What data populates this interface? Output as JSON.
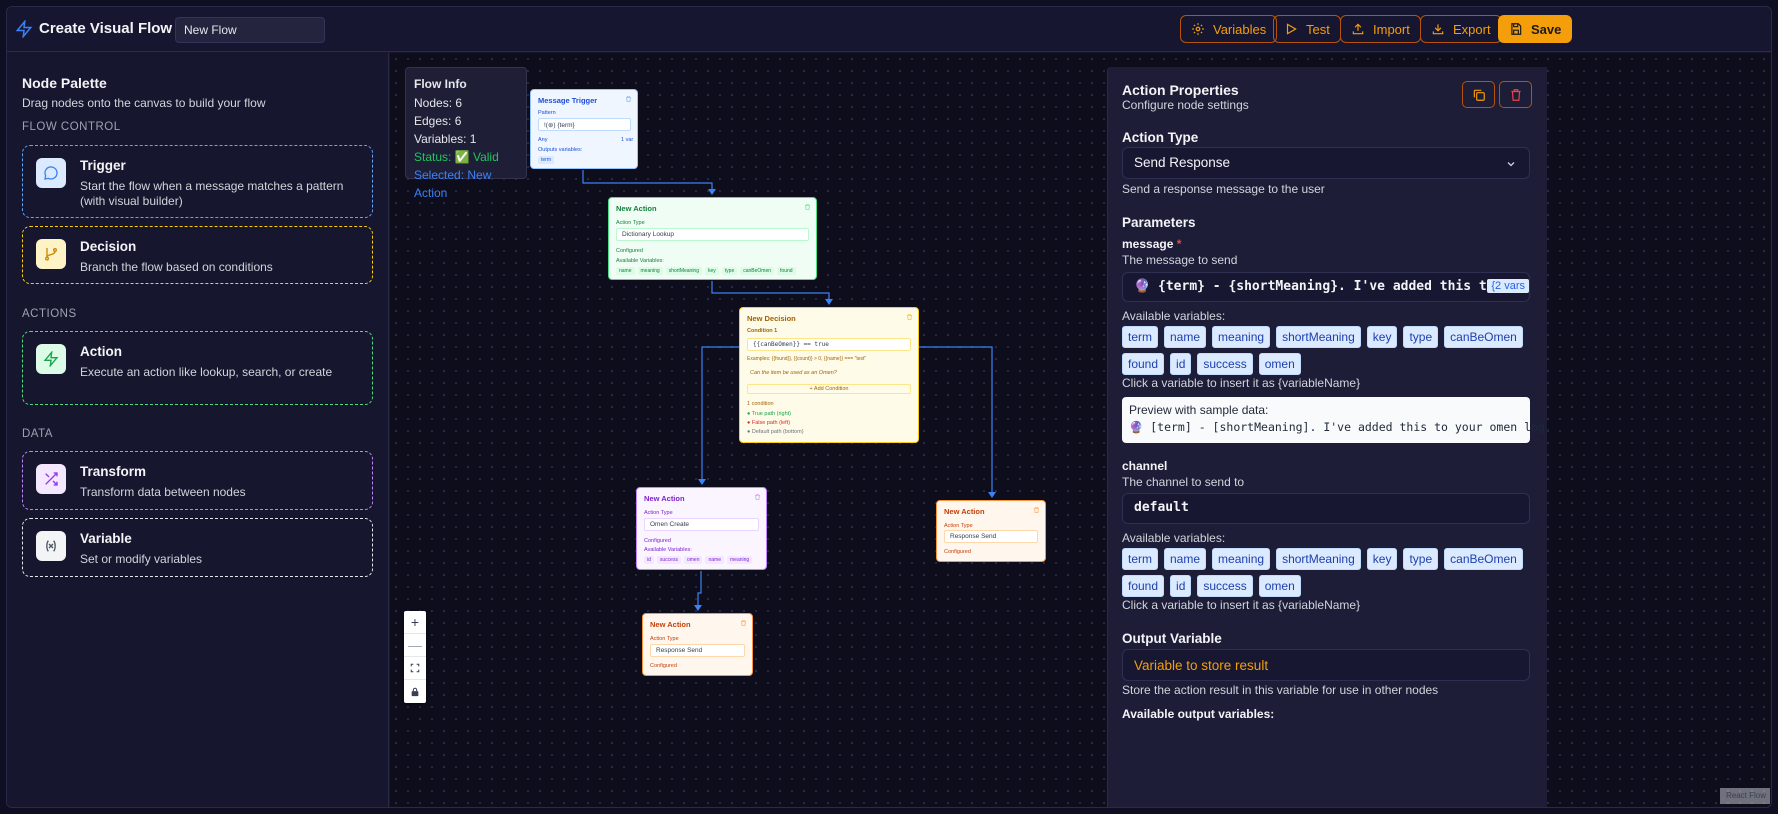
{
  "header": {
    "title": "Create Visual Flow",
    "flow_name": "New Flow",
    "buttons": {
      "variables": "Variables",
      "test": "Test",
      "import": "Import",
      "export": "Export",
      "save": "Save"
    }
  },
  "palette": {
    "title": "Node Palette",
    "subtitle": "Drag nodes onto the canvas to build your flow",
    "sections": {
      "flow_control": "FLOW CONTROL",
      "actions": "ACTIONS",
      "data": "DATA"
    },
    "items": [
      {
        "name": "Trigger",
        "desc": "Start the flow when a message matches a pattern (with visual builder)",
        "color": "#60a5fa",
        "icon": "message-circle-icon"
      },
      {
        "name": "Decision",
        "desc": "Branch the flow based on conditions",
        "color": "#facc15",
        "icon": "git-branch-icon"
      },
      {
        "name": "Action",
        "desc": "Execute an action like lookup, search, or create",
        "color": "#4ade80",
        "icon": "zap-icon"
      },
      {
        "name": "Transform",
        "desc": "Transform data between nodes",
        "color": "#c084fc",
        "icon": "shuffle-icon"
      },
      {
        "name": "Variable",
        "desc": "Set or modify variables",
        "color": "#c084fc",
        "icon": "variable-icon"
      }
    ]
  },
  "flow_info": {
    "title": "Flow Info",
    "nodes": "Nodes: 6",
    "edges": "Edges: 6",
    "variables": "Variables: 1",
    "status": "Status: ✅ Valid",
    "selected": "Selected: New Action"
  },
  "nodes": {
    "trigger": {
      "title": "Message Trigger",
      "pattern_label": "Pattern",
      "pattern": "!(⊛) {term}",
      "any": "Any",
      "var_count": "1 var",
      "outputs_label": "Outputs variables:",
      "outputs": [
        "term"
      ]
    },
    "action1": {
      "title": "New Action",
      "type_label": "Action Type",
      "type": "Dictionary Lookup",
      "status": "Configured",
      "vars_label": "Available Variables:",
      "vars": [
        "name",
        "meaning",
        "shortMeaning",
        "key",
        "type",
        "canBeOmen",
        "found"
      ]
    },
    "decision": {
      "title": "New Decision",
      "cond_label": "Condition 1",
      "cond": "{{canBeOmen}} == true",
      "example": "Examples: {{found}}, {{count}} > 0, {{name}} === \"test\"",
      "question": "Can the item be used as an Omen?",
      "add": "+ Add Condition",
      "count": "1 condition",
      "true_path": "True path (right)",
      "false_path": "False path (left)",
      "default_path": "Default path (bottom)"
    },
    "action2": {
      "title": "New Action",
      "type_label": "Action Type",
      "type": "Omen Create",
      "status": "Configured",
      "vars_label": "Available Variables:",
      "vars": [
        "id",
        "success",
        "omen",
        "name",
        "meaning"
      ]
    },
    "action3": {
      "title": "New Action",
      "type_label": "Action Type",
      "type": "Response Send",
      "status": "Configured"
    },
    "action4": {
      "title": "New Action",
      "type_label": "Action Type",
      "type": "Response Send",
      "status": "Configured"
    }
  },
  "zoom": {
    "in": "+",
    "out": "—"
  },
  "attribution": "React Flow",
  "props": {
    "title": "Action Properties",
    "subtitle": "Configure node settings",
    "action_type_label": "Action Type",
    "action_type": "Send Response",
    "action_type_help": "Send a response message to the user",
    "params_label": "Parameters",
    "message": {
      "label": "message",
      "required": "*",
      "help": "The message to send",
      "value": "🔮 {term} - {shortMeaning}. I've added this to",
      "vars_badge": "{2 vars"
    },
    "available_label": "Available variables:",
    "variables": [
      "term",
      "name",
      "meaning",
      "shortMeaning",
      "key",
      "type",
      "canBeOmen",
      "found",
      "id",
      "success",
      "omen"
    ],
    "click_help": "Click a variable to insert it as {variableName}",
    "preview_label": "Preview with sample data:",
    "preview_value": "🔮 [term] - [shortMeaning]. I've added this to your omen log.",
    "channel": {
      "label": "channel",
      "help": "The channel to send to",
      "value": "default"
    },
    "output_label": "Output Variable",
    "output_placeholder": "Variable to store result",
    "output_help": "Store the action result in this variable for use in other nodes",
    "available_output_label": "Available output variables:"
  },
  "colors": {
    "accent": "#f59e0b",
    "trigger": "#60a5fa",
    "decision": "#facc15",
    "action": "#4ade80",
    "data": "#c084fc"
  }
}
